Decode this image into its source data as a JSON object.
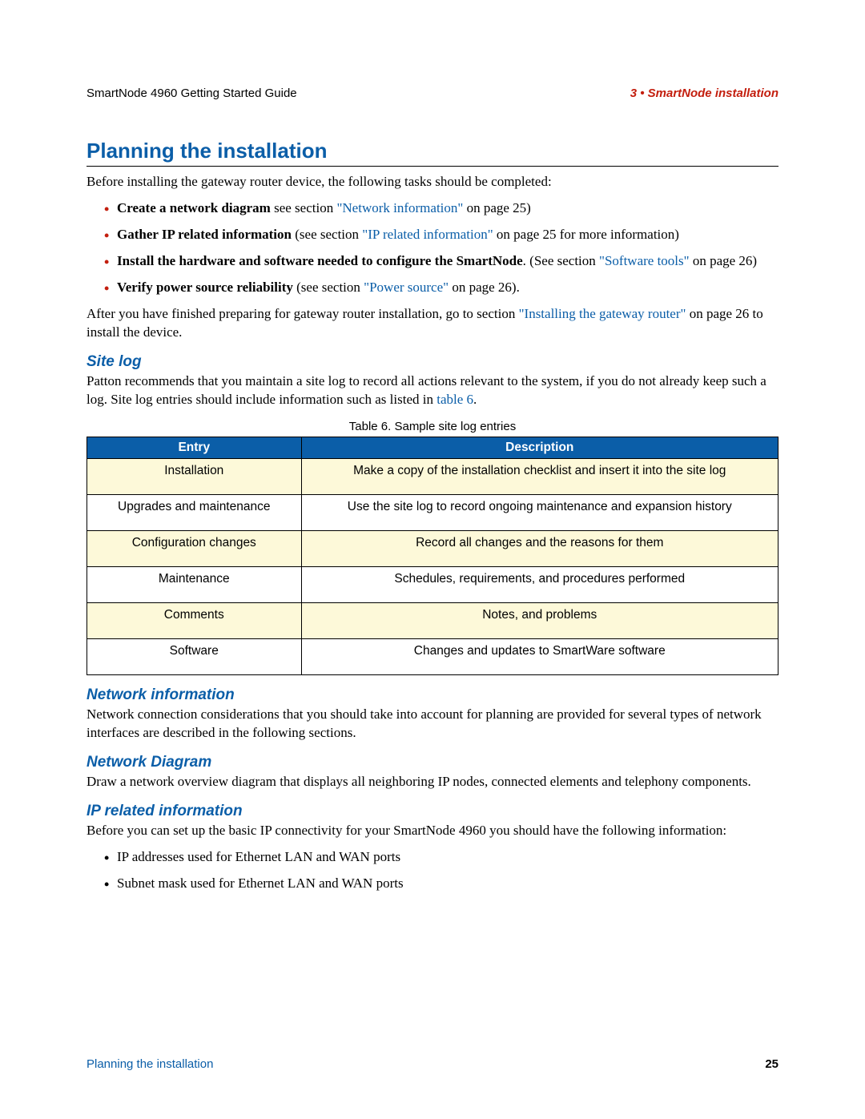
{
  "header": {
    "left": "SmartNode 4960 Getting Started Guide",
    "right": "3 • SmartNode installation"
  },
  "title": "Planning the installation",
  "intro": "Before installing the gateway router device, the following tasks should be completed:",
  "bullets": [
    {
      "bold": "Create a network diagram",
      "pre": " see section ",
      "link": "\"Network information\"",
      "post": " on page 25)"
    },
    {
      "bold": "Gather IP related information",
      "pre": " (see section ",
      "link": "\"IP related information\"",
      "post": " on page 25 for more information)"
    },
    {
      "bold": "Install the hardware and software needed to configure the SmartNode",
      "pre": ". (See section ",
      "link": "\"Software tools\"",
      "post": " on page 26)"
    },
    {
      "bold": "Verify power source reliability",
      "pre": " (see section ",
      "link": "\"Power source\"",
      "post": " on page 26)."
    }
  ],
  "after_bullets": {
    "pre": "After you have finished preparing for gateway router installation, go to section ",
    "link": "\"Installing the gateway router\"",
    "post": " on page 26 to install the device."
  },
  "sitelog": {
    "heading": "Site log",
    "para_pre": "Patton recommends that you maintain a site log to record all actions relevant to the system, if you do not already keep such a log. Site log entries should include information such as listed in ",
    "para_link": "table 6",
    "para_post": "."
  },
  "table": {
    "caption": "Table 6. Sample site log entries",
    "head": {
      "c1": "Entry",
      "c2": "Description"
    },
    "rows": [
      {
        "c1": "Installation",
        "c2": "Make a copy of the installation checklist and insert it into the site log"
      },
      {
        "c1": "Upgrades and maintenance",
        "c2": "Use the site log to record ongoing maintenance and expansion history"
      },
      {
        "c1": "Configuration changes",
        "c2": "Record all changes and the reasons for them"
      },
      {
        "c1": "Maintenance",
        "c2": "Schedules, requirements, and procedures performed"
      },
      {
        "c1": "Comments",
        "c2": "Notes, and problems"
      },
      {
        "c1": "Software",
        "c2": "Changes and updates to SmartWare software"
      }
    ]
  },
  "netinfo": {
    "heading": "Network information",
    "para": "Network connection considerations that you should take into account for planning are provided for several types of network interfaces are described in the following sections."
  },
  "netdiagram": {
    "heading": "Network Diagram",
    "para": "Draw a network overview diagram that displays all neighboring IP nodes, connected elements and telephony components."
  },
  "ipinfo": {
    "heading": "IP related information",
    "para": "Before you can set up the basic IP connectivity for your SmartNode 4960 you should have the following information:",
    "items": [
      "IP addresses used for Ethernet LAN and WAN ports",
      "Subnet mask used for Ethernet LAN and WAN ports"
    ]
  },
  "footer": {
    "left": "Planning the installation",
    "right": "25"
  }
}
